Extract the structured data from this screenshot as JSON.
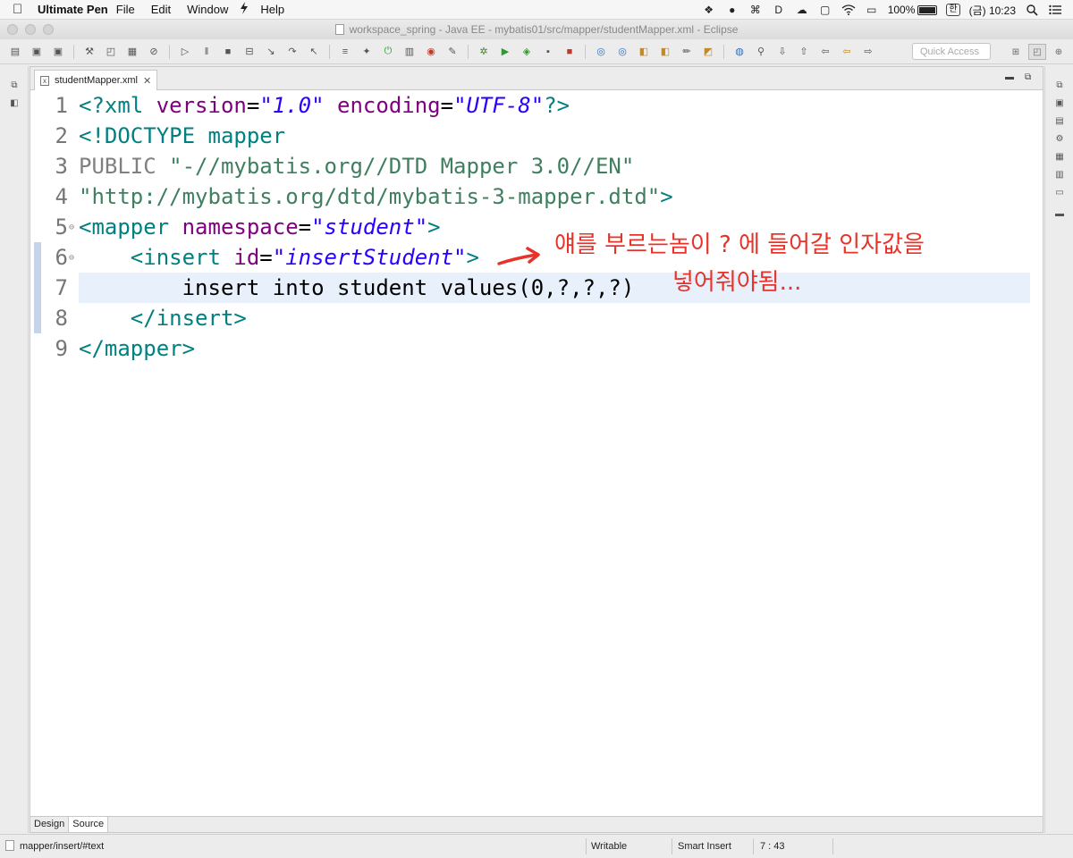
{
  "menubar": {
    "app_name": "Ultimate Pen",
    "items": [
      "File",
      "Edit",
      "Window",
      "Help"
    ],
    "battery_percent": "100%",
    "input_method": "한",
    "clock": "(금) 10:23",
    "battery_level": 1.0
  },
  "window": {
    "title": "workspace_spring - Java EE - mybatis01/src/mapper/studentMapper.xml - Eclipse"
  },
  "toolbar": {
    "quick_access_placeholder": "Quick Access"
  },
  "editor": {
    "tab_label": "studentMapper.xml",
    "tab_icon": "x",
    "line_numbers": [
      "1",
      "2",
      "3",
      "4",
      "5",
      "6",
      "7",
      "8",
      "9"
    ],
    "fold_markers": {
      "5": "⊖",
      "6": "⊖"
    },
    "current_line": 7,
    "lines": {
      "l1": {
        "a": "<?xml ",
        "b": "version",
        "c": "=",
        "d": "\"1.0\"",
        "e": " ",
        "f": "encoding",
        "g": "=",
        "h": "\"UTF-8\"",
        "i": "?>"
      },
      "l2": {
        "a": "<!DOCTYPE ",
        "b": "mapper"
      },
      "l3": {
        "a": "PUBLIC ",
        "b": "\"-//mybatis.org//DTD Mapper 3.0//EN\""
      },
      "l4": {
        "a": "\"http://mybatis.org/dtd/mybatis-3-mapper.dtd\"",
        "b": ">"
      },
      "l5": {
        "a": "<mapper ",
        "b": "namespace",
        "c": "=",
        "d": "\"student\"",
        "e": ">"
      },
      "l6": {
        "a": "    <insert ",
        "b": "id",
        "c": "=",
        "d": "\"insertStudent\"",
        "e": ">"
      },
      "l7": {
        "a": "        insert into student values(0,?,?,?)"
      },
      "l8": {
        "a": "    </insert>"
      },
      "l9": {
        "a": "</mapper>"
      }
    },
    "annotation_line1": "얘를 부르는놈이 ? 에 들어갈 인자값을",
    "annotation_line2": "넣어줘야됨...",
    "bottom_tabs": [
      "Design",
      "Source"
    ],
    "active_bottom_tab": "Source"
  },
  "statusbar": {
    "path": "mapper/insert/#text",
    "writable": "Writable",
    "insert_mode": "Smart Insert",
    "position": "7 : 43"
  }
}
